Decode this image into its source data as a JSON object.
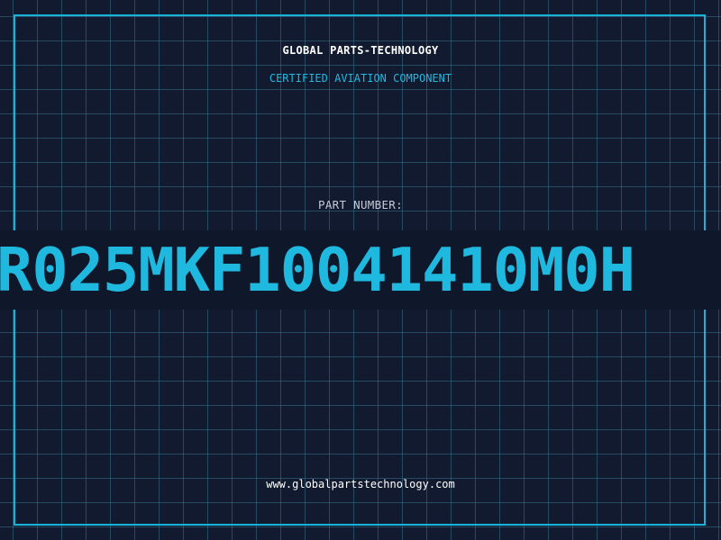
{
  "label": {
    "brand": "GLOBAL PARTS-TECHNOLOGY",
    "tagline": "CERTIFIED AVIATION COMPONENT",
    "part_label": "PART NUMBER:",
    "part_number": "R025MKF10041410M0H",
    "website": "www.globalpartstechnology.com"
  },
  "colors": {
    "background": "#111a2e",
    "grid": "#36708c",
    "accent": "#1fb8de",
    "text": "#ffffff"
  }
}
